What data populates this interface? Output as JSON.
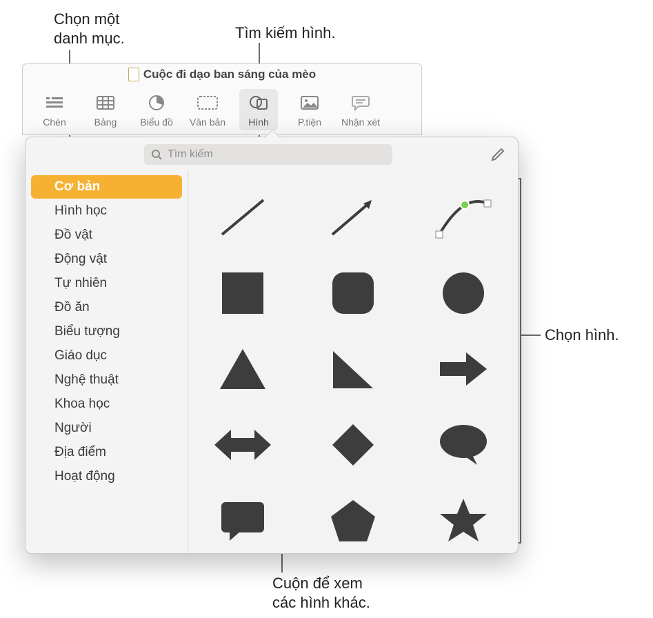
{
  "callouts": {
    "category": "Chọn một\ndanh mục.",
    "search": "Tìm kiếm hình.",
    "choose": "Chọn hình.",
    "scroll": "Cuộn để xem\ncác hình khác."
  },
  "titlebar": {
    "title": "Cuộc đi dạo ban sáng của mèo"
  },
  "toolbar": {
    "items": [
      {
        "label": "Chèn"
      },
      {
        "label": "Bảng"
      },
      {
        "label": "Biểu đồ"
      },
      {
        "label": "Văn bản"
      },
      {
        "label": "Hình"
      },
      {
        "label": "P.tiện"
      },
      {
        "label": "Nhận xét"
      }
    ]
  },
  "search": {
    "placeholder": "Tìm kiếm"
  },
  "sidebar": {
    "items": [
      {
        "label": "Cơ bản",
        "selected": true
      },
      {
        "label": "Hình học"
      },
      {
        "label": "Đồ vật"
      },
      {
        "label": "Động vật"
      },
      {
        "label": "Tự nhiên"
      },
      {
        "label": "Đồ ăn"
      },
      {
        "label": "Biểu tượng"
      },
      {
        "label": "Giáo dục"
      },
      {
        "label": "Nghệ thuật"
      },
      {
        "label": "Khoa học"
      },
      {
        "label": "Người"
      },
      {
        "label": "Địa điểm"
      },
      {
        "label": "Hoạt động"
      }
    ]
  },
  "shapes": [
    "line",
    "arrow-line",
    "curve",
    "square",
    "rounded-square",
    "circle",
    "triangle",
    "right-triangle",
    "arrow-right",
    "arrow-leftright",
    "diamond",
    "speech-bubble",
    "callout-rect",
    "pentagon",
    "star"
  ],
  "colors": {
    "accent": "#f6b133",
    "shape": "#3d3d3d",
    "node": "#7bd14b"
  }
}
